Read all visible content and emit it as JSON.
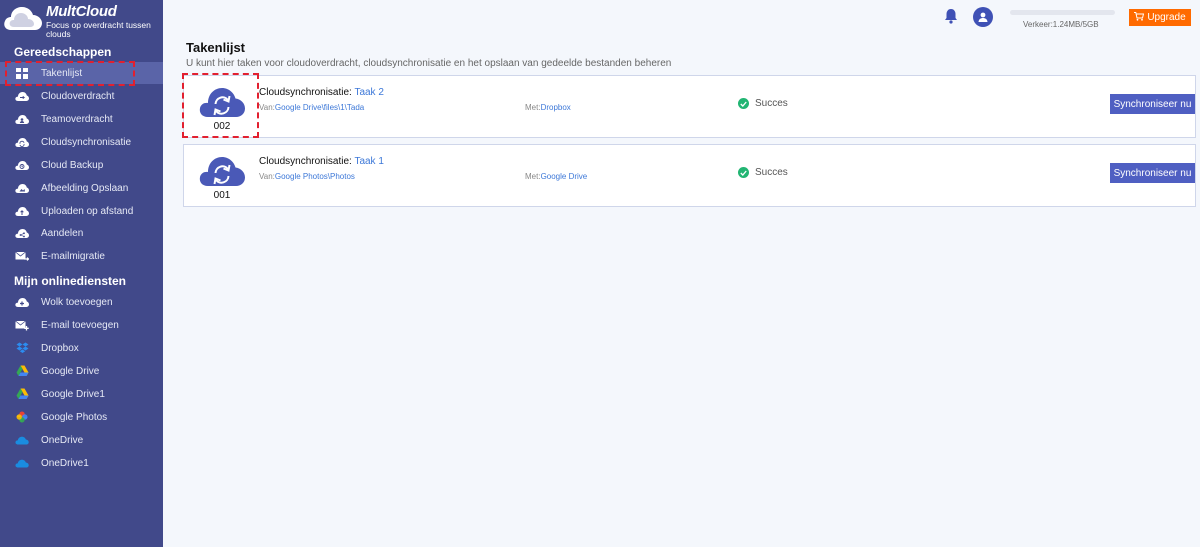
{
  "brand": {
    "name": "MultCloud",
    "tagline": "Focus op overdracht tussen clouds"
  },
  "sidebar": {
    "section1": "Gereedschappen",
    "tools": [
      {
        "label": "Takenlijst",
        "icon": "grid-icon"
      },
      {
        "label": "Cloudoverdracht",
        "icon": "cloud-transfer-icon"
      },
      {
        "label": "Teamoverdracht",
        "icon": "team-transfer-icon"
      },
      {
        "label": "Cloudsynchronisatie",
        "icon": "cloud-sync-icon"
      },
      {
        "label": "Cloud Backup",
        "icon": "cloud-backup-icon"
      },
      {
        "label": "Afbeelding Opslaan",
        "icon": "image-save-icon"
      },
      {
        "label": "Uploaden op afstand",
        "icon": "remote-upload-icon"
      },
      {
        "label": "Aandelen",
        "icon": "share-icon"
      },
      {
        "label": "E-mailmigratie",
        "icon": "email-migration-icon"
      }
    ],
    "section2": "Mijn onlinediensten",
    "services": [
      {
        "label": "Wolk toevoegen",
        "icon": "add-cloud-icon"
      },
      {
        "label": "E-mail toevoegen",
        "icon": "add-email-icon"
      },
      {
        "label": "Dropbox",
        "icon": "dropbox-icon"
      },
      {
        "label": "Google Drive",
        "icon": "google-drive-icon"
      },
      {
        "label": "Google Drive1",
        "icon": "google-drive-icon"
      },
      {
        "label": "Google Photos",
        "icon": "google-photos-icon"
      },
      {
        "label": "OneDrive",
        "icon": "onedrive-icon"
      },
      {
        "label": "OneDrive1",
        "icon": "onedrive-icon"
      }
    ]
  },
  "topbar": {
    "traffic": "Verkeer:1.24MB/5GB",
    "traffic_used_fraction": 0.0002,
    "upgrade_label": "Upgrade"
  },
  "main": {
    "title": "Takenlijst",
    "description": "U kunt hier taken voor cloudoverdracht, cloudsynchronisatie en het opslaan van gedeelde bestanden beheren",
    "tasks": [
      {
        "number": "002",
        "type": "Cloudsynchronisatie: ",
        "name": "Taak 2",
        "from_label": "Van:",
        "from": "Google Drive\\files\\1\\Tada",
        "to_label": "Met:",
        "to": "Dropbox",
        "status": "Succes",
        "action": "Synchroniseer nu"
      },
      {
        "number": "001",
        "type": "Cloudsynchronisatie: ",
        "name": "Taak 1",
        "from_label": "Van:",
        "from": "Google Photos\\Photos",
        "to_label": "Met:",
        "to": "Google Drive",
        "status": "Succes",
        "action": "Synchroniseer nu"
      }
    ]
  },
  "colors": {
    "sidebar": "#41498a",
    "accent": "#4f5fc2",
    "upgrade": "#ff6a00",
    "success": "#22b573",
    "highlight": "#e2202f"
  }
}
